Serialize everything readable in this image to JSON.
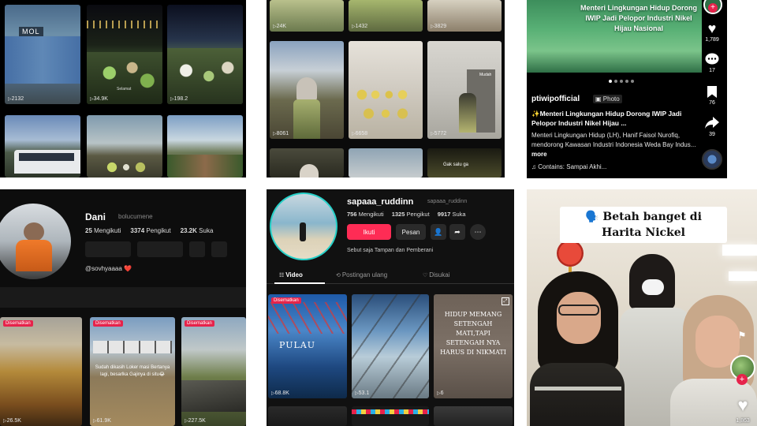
{
  "p1": {
    "counts": [
      "2132",
      "34.9K",
      "198.2"
    ],
    "sign": "MOL",
    "banner": "Selamat"
  },
  "p2": {
    "top_counts": [
      "24K",
      "1432",
      "3829"
    ],
    "mid_counts": [
      "8061",
      "6658",
      "5772"
    ],
    "small_label": "Mudah",
    "bottom_text": "Gak salu ga"
  },
  "p3": {
    "headline": "Menteri Lingkungan Hidup Dorong IWIP Jadi Pelopor Industri Nikel Hijau Nasional",
    "like_count": "1,789",
    "comment_count": "17",
    "save_count": "76",
    "share_count": "39",
    "username": "ptiwipofficial",
    "photo_badge": "Photo",
    "caption_title": "✨Menteri Lingkungan Hidup Dorong IWIP Jadi Pelopor Industri Nikel Hijau ...",
    "caption_body": "Menteri Lingkungan Hidup (LH), Hanif Faisol Nurofiq, mendorong Kawasan Industri Indonesia Weda Bay Indus...",
    "more": "more",
    "sound": "♫ Contains: Sampai Akhi..."
  },
  "p4": {
    "name": "Dani",
    "handle": "bolucumene",
    "following_num": "25",
    "following_lbl": "Mengikuti",
    "followers_num": "3374",
    "followers_lbl": "Pengikut",
    "likes_num": "23.2K",
    "likes_lbl": "Suka",
    "bio": "@sovhyaaaa ❤️",
    "pinned": [
      "Disematkan",
      "Disematkan",
      "Disematkan"
    ],
    "counts": [
      "26.5K",
      "61.9K",
      "227.5K"
    ],
    "caption": "Sudah dikasih Loker masi Bertanya lagi, besarlka Gajinya di situ😂"
  },
  "p5": {
    "username": "sapaaa_ruddinn",
    "handle": "sapaaa_ruddinn",
    "following_num": "756",
    "following_lbl": "Mengikuti",
    "followers_num": "1325",
    "followers_lbl": "Pengikut",
    "likes_num": "9917",
    "likes_lbl": "Suka",
    "follow_btn": "Ikuti",
    "message_btn": "Pesan",
    "bio": "Sebut saja Tampan dan Pemberani",
    "tabs": [
      "Video",
      "Postingan ulang",
      "Disukai"
    ],
    "pinned": "Disematkan",
    "counts": [
      "68.8K",
      "53.1",
      "6"
    ],
    "thumb1_text": "PULAU",
    "quote": "HIDUP MEMANG SETENGAH MATI,TAPI SETENGAH NYA HARUS DI NIKMATI"
  },
  "p6": {
    "title": "🗣️ Betah banget di Harita Nickel",
    "like_count": "1,863"
  }
}
